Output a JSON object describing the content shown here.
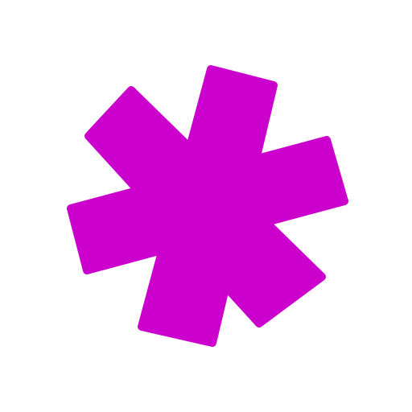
{
  "icon": {
    "name": "asterisk-icon",
    "color": "#cc00cc",
    "background": "#ffffff"
  }
}
